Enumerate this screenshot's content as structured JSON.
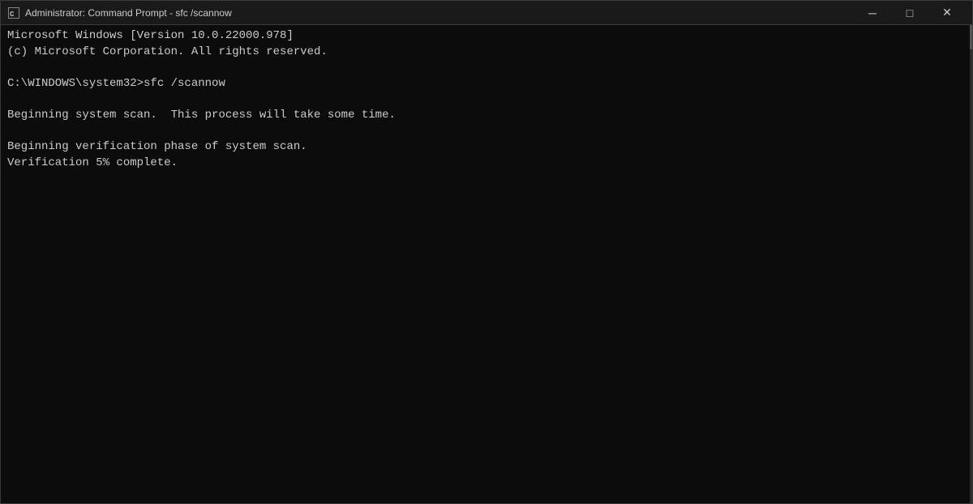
{
  "window": {
    "title": "Administrator: Command Prompt - sfc  /scannow",
    "icon_label": "cmd-icon"
  },
  "titlebar": {
    "minimize_label": "─",
    "maximize_label": "□",
    "close_label": "✕"
  },
  "terminal": {
    "lines": [
      "Microsoft Windows [Version 10.0.22000.978]",
      "(c) Microsoft Corporation. All rights reserved.",
      "",
      "C:\\WINDOWS\\system32>sfc /scannow",
      "",
      "Beginning system scan.  This process will take some time.",
      "",
      "Beginning verification phase of system scan.",
      "Verification 5% complete."
    ]
  }
}
